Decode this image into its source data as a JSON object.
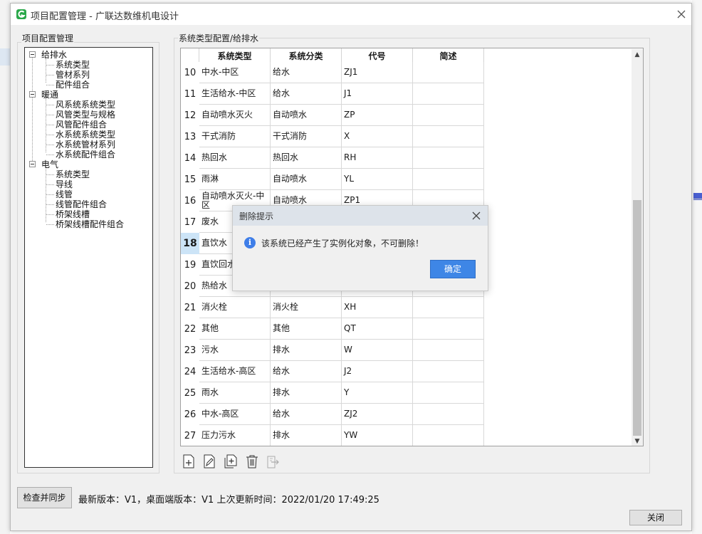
{
  "window": {
    "title": "项目配置管理 - 广联达数维机电设计"
  },
  "tree_panel": {
    "title": "项目配置管理",
    "nodes": [
      {
        "label": "给排水",
        "level": 0,
        "expanded": true
      },
      {
        "label": "系统类型",
        "level": 1
      },
      {
        "label": "管材系列",
        "level": 1
      },
      {
        "label": "配件组合",
        "level": 1
      },
      {
        "label": "暖通",
        "level": 0,
        "expanded": true
      },
      {
        "label": "风系统系统类型",
        "level": 1
      },
      {
        "label": "风管类型与规格",
        "level": 1
      },
      {
        "label": "风管配件组合",
        "level": 1
      },
      {
        "label": "水系统系统类型",
        "level": 1
      },
      {
        "label": "水系统管材系列",
        "level": 1
      },
      {
        "label": "水系统配件组合",
        "level": 1
      },
      {
        "label": "电气",
        "level": 0,
        "expanded": true
      },
      {
        "label": "系统类型",
        "level": 1
      },
      {
        "label": "导线",
        "level": 1
      },
      {
        "label": "线管",
        "level": 1
      },
      {
        "label": "线管配件组合",
        "level": 1
      },
      {
        "label": "桥架线槽",
        "level": 1
      },
      {
        "label": "桥架线槽配件组合",
        "level": 1
      }
    ]
  },
  "grid_panel": {
    "title": "系统类型配置/给排水",
    "columns": [
      "系统类型",
      "系统分类",
      "代号",
      "简述"
    ],
    "selected_row": "18",
    "rows": [
      [
        "10",
        "中水-中区",
        "给水",
        "ZJ1",
        ""
      ],
      [
        "11",
        "生活给水-中区",
        "给水",
        "J1",
        ""
      ],
      [
        "12",
        "自动喷水灭火",
        "自动喷水",
        "ZP",
        ""
      ],
      [
        "13",
        "干式消防",
        "干式消防",
        "X",
        ""
      ],
      [
        "14",
        "热回水",
        "热回水",
        "RH",
        ""
      ],
      [
        "15",
        "雨淋",
        "自动喷水",
        "YL",
        ""
      ],
      [
        "16",
        "自动喷水灭火-中区",
        "自动喷水",
        "ZP1",
        ""
      ],
      [
        "17",
        "废水",
        "",
        "",
        ""
      ],
      [
        "18",
        "直饮水",
        "",
        "",
        ""
      ],
      [
        "19",
        "直饮回水",
        "",
        "",
        ""
      ],
      [
        "20",
        "热给水",
        "",
        "",
        ""
      ],
      [
        "21",
        "消火栓",
        "消火栓",
        "XH",
        ""
      ],
      [
        "22",
        "其他",
        "其他",
        "QT",
        ""
      ],
      [
        "23",
        "污水",
        "排水",
        "W",
        ""
      ],
      [
        "24",
        "生活给水-高区",
        "给水",
        "J2",
        ""
      ],
      [
        "25",
        "雨水",
        "排水",
        "Y",
        ""
      ],
      [
        "26",
        "中水-高区",
        "给水",
        "ZJ2",
        ""
      ],
      [
        "27",
        "压力污水",
        "排水",
        "YW",
        ""
      ]
    ],
    "toolbar": [
      "add-icon",
      "edit-icon",
      "copy-add-icon",
      "delete-icon",
      "import-icon"
    ]
  },
  "footer": {
    "sync_button": "检查并同步",
    "version_info": "最新版本：V1，桌面端版本：V1 上次更新时间：2022/01/20 17:49:25",
    "close_button": "关闭"
  },
  "dialog": {
    "title": "删除提示",
    "message": "该系统已经产生了实例化对象，不可删除！",
    "ok_button": "确定",
    "icon": "info-icon"
  },
  "colors": {
    "accent": "#3e86e6",
    "selected_row": "#cce4f7"
  }
}
